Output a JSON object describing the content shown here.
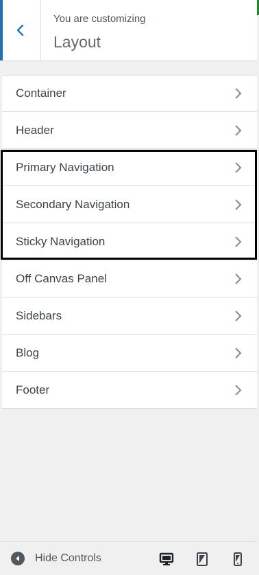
{
  "header": {
    "subtitle": "You are customizing",
    "title": "Layout",
    "back_icon": "chevron-left-icon",
    "accent_color": "#2271b1"
  },
  "menu": {
    "items": [
      {
        "label": "Container"
      },
      {
        "label": "Header"
      },
      {
        "label": "Primary Navigation"
      },
      {
        "label": "Secondary Navigation"
      },
      {
        "label": "Sticky Navigation"
      },
      {
        "label": "Off Canvas Panel"
      },
      {
        "label": "Sidebars"
      },
      {
        "label": "Blog"
      },
      {
        "label": "Footer"
      }
    ],
    "item_icon": "chevron-right-icon",
    "highlight_color": "#000000"
  },
  "footer": {
    "hide_controls_label": "Hide Controls",
    "devices": [
      "desktop-icon",
      "tablet-icon",
      "mobile-icon"
    ]
  }
}
